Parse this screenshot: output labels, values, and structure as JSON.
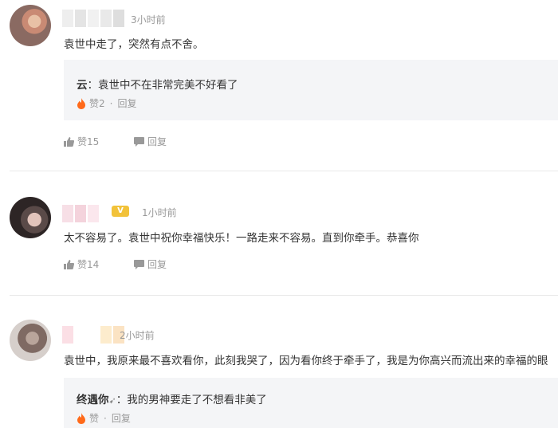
{
  "comments": [
    {
      "time": "3小时前",
      "text": "袁世中走了，突然有点不舍。",
      "reply": {
        "user": "云",
        "text": "：袁世中不在非常完美不好看了",
        "like_label": "赞2",
        "reply_label": "回复"
      },
      "like_label": "赞15",
      "reply_label": "回复"
    },
    {
      "time": "1小时前",
      "text": "太不容易了。袁世中祝你幸福快乐！一路走来不容易。直到你牵手。恭喜你",
      "like_label": "赞14",
      "reply_label": "回复"
    },
    {
      "time": "2小时前",
      "text": "袁世中，我原来最不喜欢看你，此刻我哭了，因为看你终于牵手了，我是为你高兴而流出来的幸福的眼",
      "reply": {
        "user": "终遇你",
        "text": "：我的男神要走了不想看非美了",
        "like_label": "赞",
        "reply_label": "回复"
      }
    }
  ],
  "separator": "·",
  "colors": {
    "fire": "#ff6a1a",
    "meta": "#999999",
    "reply_bg": "#f4f5f7"
  }
}
